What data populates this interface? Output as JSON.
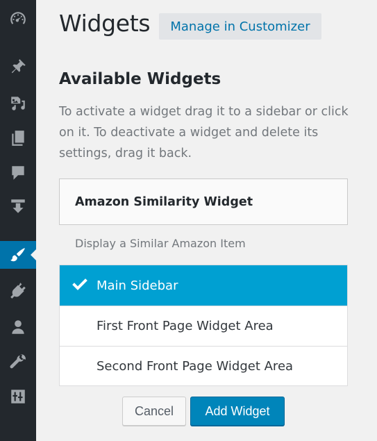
{
  "sidebar": {
    "items": [
      {
        "icon": "dashboard-icon"
      },
      {
        "icon": "pin-icon"
      },
      {
        "icon": "media-icon"
      },
      {
        "icon": "pages-icon"
      },
      {
        "icon": "comments-icon"
      },
      {
        "icon": "download-icon"
      },
      {
        "icon": "paintbrush-icon",
        "current": true
      },
      {
        "icon": "plugins-icon"
      },
      {
        "icon": "users-icon"
      },
      {
        "icon": "tools-icon"
      },
      {
        "icon": "settings-icon"
      }
    ]
  },
  "header": {
    "title": "Widgets",
    "customizer_label": "Manage in Customizer"
  },
  "available": {
    "title": "Available Widgets",
    "description": "To activate a widget drag it to a sidebar or click on it. To deactivate a widget and delete its settings, drag it back."
  },
  "widget": {
    "name": "Amazon Similarity Widget",
    "description": "Display a Similar Amazon Item"
  },
  "chooser": {
    "areas": [
      {
        "label": "Main Sidebar",
        "selected": true
      },
      {
        "label": "First Front Page Widget Area",
        "selected": false
      },
      {
        "label": "Second Front Page Widget Area",
        "selected": false
      }
    ]
  },
  "actions": {
    "cancel_label": "Cancel",
    "add_label": "Add Widget"
  },
  "colors": {
    "sidebar_bg": "#23282d",
    "accent": "#0073aa",
    "selected_area": "#00a0d2",
    "primary_button": "#0085ba"
  }
}
